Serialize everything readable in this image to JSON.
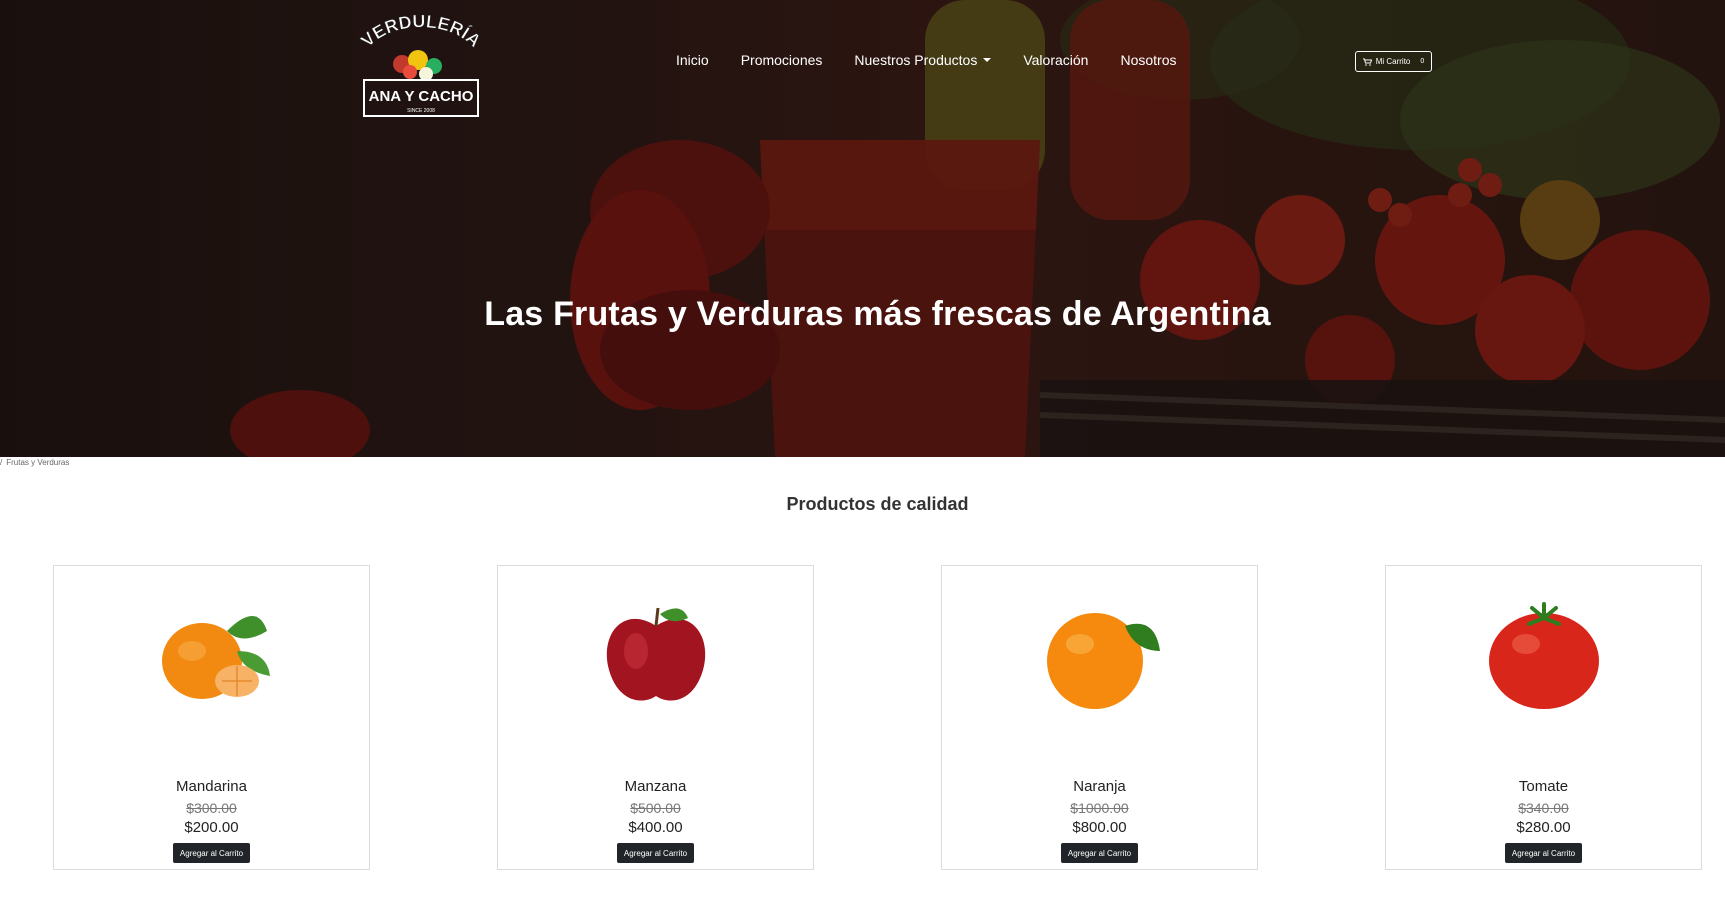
{
  "brand": {
    "line1": "VERDULERÍA",
    "line2": "ANA Y CACHO",
    "since": "SINCE 2008"
  },
  "nav": {
    "items": [
      {
        "label": "Inicio"
      },
      {
        "label": "Promociones"
      },
      {
        "label": "Nuestros Productos",
        "dropdown": true
      },
      {
        "label": "Valoración"
      },
      {
        "label": "Nosotros"
      }
    ]
  },
  "cart": {
    "label": "Mi Carrito",
    "count": "0"
  },
  "hero": {
    "title": "Las Frutas y Verduras más frescas de Argentina"
  },
  "breadcrumb": {
    "items": [
      "/",
      "Frutas y Verduras"
    ]
  },
  "section": {
    "title": "Productos de calidad"
  },
  "products": [
    {
      "name": "Mandarina",
      "old_price": "$300.00",
      "price": "$200.00",
      "button": "Agregar al Carrito",
      "icon": "mandarin-image"
    },
    {
      "name": "Manzana",
      "old_price": "$500.00",
      "price": "$400.00",
      "button": "Agregar al Carrito",
      "icon": "apple-image"
    },
    {
      "name": "Naranja",
      "old_price": "$1000.00",
      "price": "$800.00",
      "button": "Agregar al Carrito",
      "icon": "orange-image"
    },
    {
      "name": "Tomate",
      "old_price": "$340.00",
      "price": "$280.00",
      "button": "Agregar al Carrito",
      "icon": "tomato-image"
    }
  ],
  "colors": {
    "button_bg": "#212529",
    "hero_dark": "#2a1a15"
  }
}
